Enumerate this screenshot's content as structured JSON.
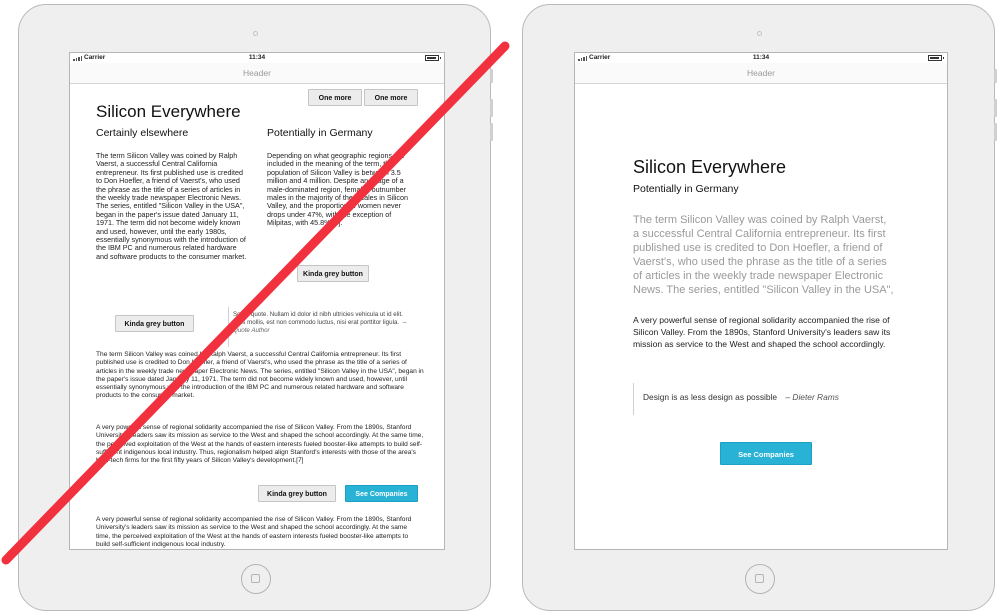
{
  "left_device": {
    "status": {
      "carrier": "Carrier",
      "time": "11:34"
    },
    "header": "Header",
    "buttons": {
      "one_more_1": "One more",
      "one_more_2": "One more",
      "kinda_grey_1": "Kinda grey button",
      "kinda_grey_2": "Kinda grey button",
      "kinda_grey_3": "Kinda grey button",
      "see_companies": "See Companies"
    },
    "title": "Silicon Everywhere",
    "col1_heading": "Certainly elsewhere",
    "col2_heading": "Potentially in Germany",
    "col1_text": "The term Silicon Valley was coined by Ralph Vaerst, a successful Central California entrepreneur. Its first published use is credited to Don Hoefler, a friend of Vaerst's, who used the phrase as the title of a series of articles in the weekly trade newspaper Electronic News. The series, entitled \"Silicon Valley in the USA\", began in the paper's issue dated January 11, 1971. The term did not become widely known and used, however, until the early 1980s, essentially synonymous with the introduction of the IBM PC and numerous related hardware and software products to the consumer market.",
    "col2_text": "Depending on what geographic regions are included in the meaning of the term, the population of Silicon Valley is between 3.5 million and 4 million. Despite an image of a male-dominated region, females outnumber males in the majority of the locales in Silicon Valley, and the proportion of women never drops under 47%, with the exception of Milpitas, with 45.8% [4].",
    "quote_text": "Some quote. Nullam id dolor id nibh ultricies vehicula ut id elit. Duis mollis, est non commodo luctus, nisi erat porttitor ligula.",
    "quote_author": "– Quote Author",
    "para1": "The term Silicon Valley was coined by Ralph Vaerst, a successful Central California entrepreneur. Its first published use is credited to Don Hoefler, a friend of Vaerst's, who used the phrase as the title of a series of articles in the weekly trade newspaper Electronic News. The series, entitled \"Silicon Valley in the USA\", began in the paper's issue dated January 11, 1971. The term did not become widely known and used, however, until essentially synonymous with the introduction of the IBM PC and numerous related hardware and software products to the consumer market.",
    "para2": "A very powerful sense of regional solidarity accompanied the rise of Silicon Valley. From the 1890s, Stanford University's leaders saw its mission as service to the West and shaped the school accordingly. At the same time, the perceived exploitation of the West at the hands of eastern interests fueled booster-like attempts to build self-sufficient indigenous local industry. Thus, regionalism helped align Stanford's interests with those of the area's high-tech firms for the first fifty years of Silicon Valley's development.[7]",
    "para3": "A very powerful sense of regional solidarity accompanied the rise of Silicon Valley. From the 1890s, Stanford University's leaders saw its mission as service to the West and shaped the school accordingly. At the same time, the perceived exploitation of the West at the hands of eastern interests fueled booster-like attempts to build self-sufficient indigenous local industry."
  },
  "right_device": {
    "status": {
      "carrier": "Carrier",
      "time": "11:34"
    },
    "header": "Header",
    "title": "Silicon Everywhere",
    "subtitle": "Potentially in Germany",
    "lead": "The term Silicon Valley was coined by Ralph Vaerst, a successful Central California entrepreneur. Its first published use is credited to Don Hoefler, a friend of Vaerst's, who used the phrase as the title of a series of articles in the weekly trade newspaper Electronic News. The series, entitled \"Silicon Valley in the USA\", began in the paper's issue dated January 11, 1971.",
    "body": "A very powerful sense of regional solidarity accompanied the rise of Silicon Valley. From the 1890s, Stanford University's leaders saw its mission as service to the West and shaped the school accordingly.",
    "quote": "Design is as less design as possible",
    "quote_author": "– Dieter Rams",
    "button": "See Companies"
  },
  "colors": {
    "accent": "#27b2d6",
    "strike": "#f2313f",
    "device": "#efefef"
  }
}
